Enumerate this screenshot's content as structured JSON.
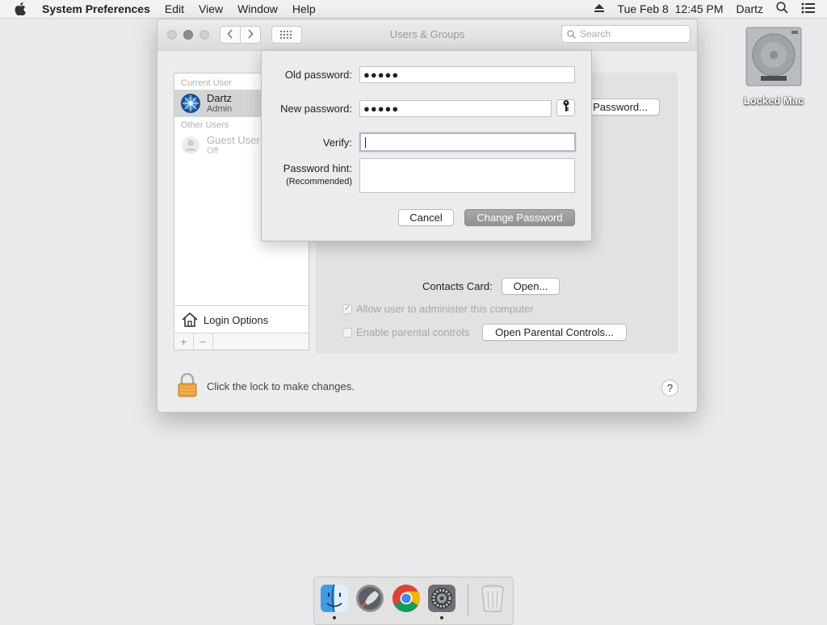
{
  "menubar": {
    "app_name": "System Preferences",
    "menus": [
      "Edit",
      "View",
      "Window",
      "Help"
    ],
    "clock": "Tue Feb 8  12:45 PM",
    "user": "Dartz"
  },
  "desktop": {
    "drive_label": "Locked Mac"
  },
  "window": {
    "title": "Users & Groups",
    "search_placeholder": "Search"
  },
  "sidebar": {
    "current_user_header": "Current User",
    "current_user": {
      "name": "Dartz",
      "role": "Admin"
    },
    "other_users_header": "Other Users",
    "other_user": {
      "name": "Guest User",
      "status": "Off"
    },
    "login_options": "Login Options",
    "add": "+",
    "remove": "−"
  },
  "panel": {
    "password_button": "Password...",
    "contacts_card_label": "Contacts Card:",
    "open_button": "Open...",
    "allow_admin_label": "Allow user to administer this computer",
    "allow_admin_checked": true,
    "parental_controls_label": "Enable parental controls",
    "parental_controls_checked": false,
    "open_parental_button": "Open Parental Controls..."
  },
  "footer": {
    "lock_text": "Click the lock to make changes.",
    "help": "?"
  },
  "dialog": {
    "old_password_label": "Old password:",
    "old_password_value": "●●●●●",
    "new_password_label": "New password:",
    "new_password_value": "●●●●●",
    "verify_label": "Verify:",
    "verify_value": "",
    "hint_label": "Password hint:",
    "hint_sub": "(Recommended)",
    "hint_value": "",
    "cancel": "Cancel",
    "change": "Change Password"
  },
  "dock": {
    "items": [
      "finder-icon",
      "launchpad-icon",
      "chrome-icon",
      "system-preferences-icon",
      "trash-icon"
    ]
  },
  "colors": {
    "desktop": "#e9eaec",
    "primary_button": "#9d9d9d",
    "selection": "#d4d4d4"
  }
}
